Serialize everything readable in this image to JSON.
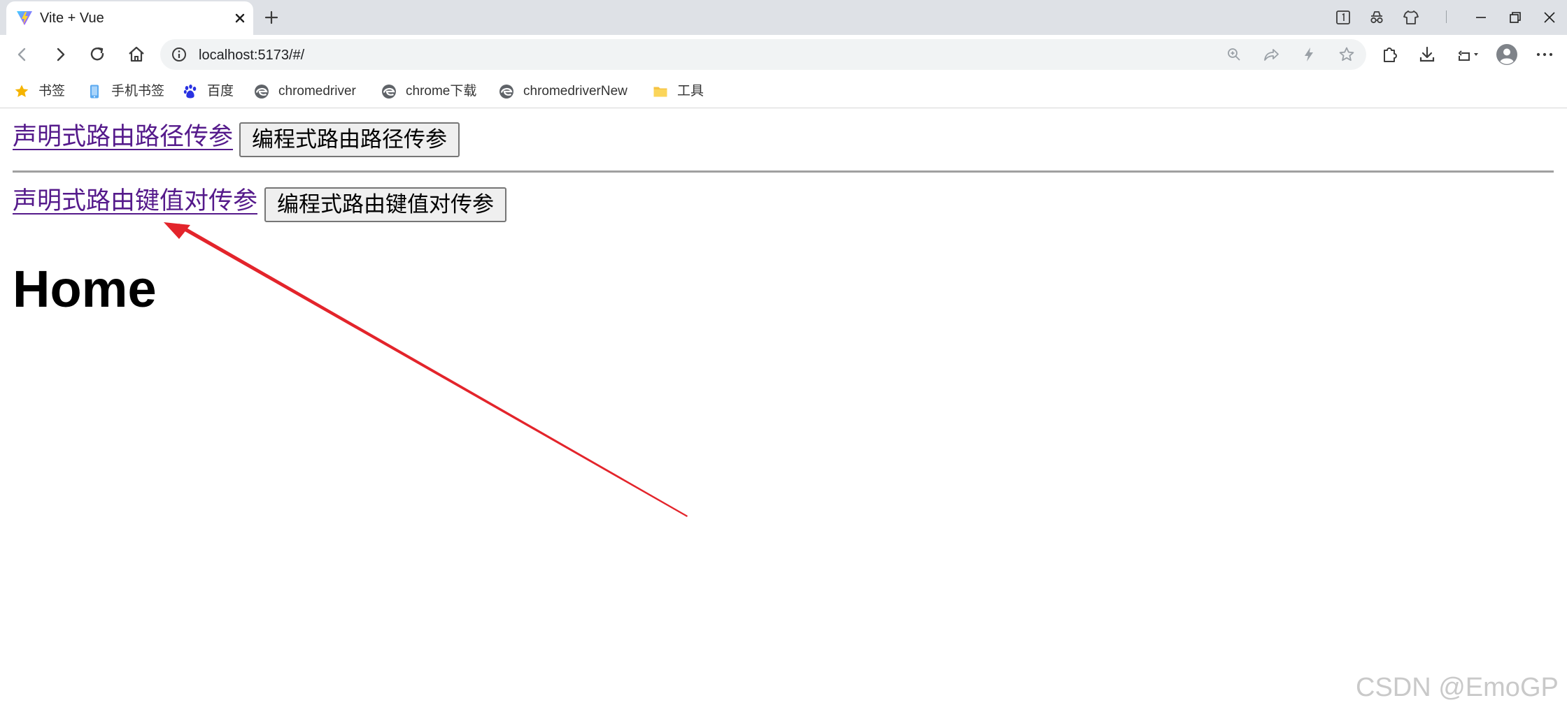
{
  "browser": {
    "tab": {
      "title": "Vite + Vue",
      "favicon": "vite-logo-icon"
    },
    "window_controls": [
      "minimize-icon",
      "restore-icon",
      "close-icon"
    ],
    "address": {
      "url": "localhost:5173/#/"
    },
    "bookmarks": [
      {
        "label": "书签",
        "icon": "star-icon"
      },
      {
        "label": "手机书签",
        "icon": "mobile-icon"
      },
      {
        "label": "百度",
        "icon": "baidu-paw-icon"
      },
      {
        "label": "chromedriver",
        "icon": "edge-logo-icon"
      },
      {
        "label": "chrome下载",
        "icon": "edge-logo-icon"
      },
      {
        "label": "chromedriverNew",
        "icon": "edge-logo-icon"
      },
      {
        "label": "工具",
        "icon": "folder-icon"
      }
    ]
  },
  "page": {
    "link_path": "声明式路由路径传参",
    "button_path": "编程式路由路径传参",
    "link_query": "声明式路由键值对传参",
    "button_query": "编程式路由键值对传参",
    "view_title": "Home"
  },
  "annotation": {
    "color": "#e3242b"
  },
  "watermark": "CSDN @EmoGP",
  "colors": {
    "link_visited": "#551a8b",
    "tabstrip_bg": "#dee1e6",
    "omnibox_bg": "#f1f3f4"
  }
}
